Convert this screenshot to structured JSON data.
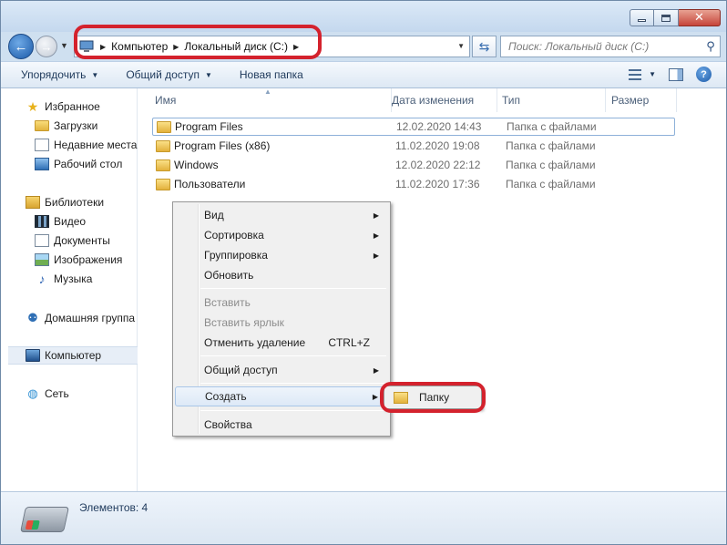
{
  "address": {
    "crumbs": [
      "Компьютер",
      "Локальный диск (C:)"
    ]
  },
  "search": {
    "placeholder": "Поиск: Локальный диск (C:)"
  },
  "toolbar": {
    "organize_label": "Упорядочить",
    "share_label": "Общий доступ",
    "new_folder_label": "Новая папка"
  },
  "sidebar": {
    "favorites": {
      "label": "Избранное",
      "items": [
        "Загрузки",
        "Недавние места",
        "Рабочий стол"
      ]
    },
    "libraries": {
      "label": "Библиотеки",
      "items": [
        "Видео",
        "Документы",
        "Изображения",
        "Музыка"
      ]
    },
    "homegroup": "Домашняя группа",
    "computer": "Компьютер",
    "network": "Сеть"
  },
  "columns": {
    "name": "Имя",
    "date": "Дата изменения",
    "type": "Тип",
    "size": "Размер"
  },
  "files": [
    {
      "name": "Program Files",
      "date": "12.02.2020 14:43",
      "type": "Папка с файлами"
    },
    {
      "name": "Program Files (x86)",
      "date": "11.02.2020 19:08",
      "type": "Папка с файлами"
    },
    {
      "name": "Windows",
      "date": "12.02.2020 22:12",
      "type": "Папка с файлами"
    },
    {
      "name": "Пользователи",
      "date": "11.02.2020 17:36",
      "type": "Папка с файлами"
    }
  ],
  "context_menu": {
    "view": "Вид",
    "sort": "Сортировка",
    "group": "Группировка",
    "refresh": "Обновить",
    "paste": "Вставить",
    "paste_shortcut": "Вставить ярлык",
    "undo_delete": "Отменить удаление",
    "undo_accel": "CTRL+Z",
    "share": "Общий доступ",
    "create": "Создать",
    "properties": "Свойства"
  },
  "submenu": {
    "folder": "Папку"
  },
  "status": {
    "items_count": "Элементов: 4"
  },
  "colors": {
    "highlight_ring": "#d4222d",
    "accent": "#1b5aa8"
  }
}
